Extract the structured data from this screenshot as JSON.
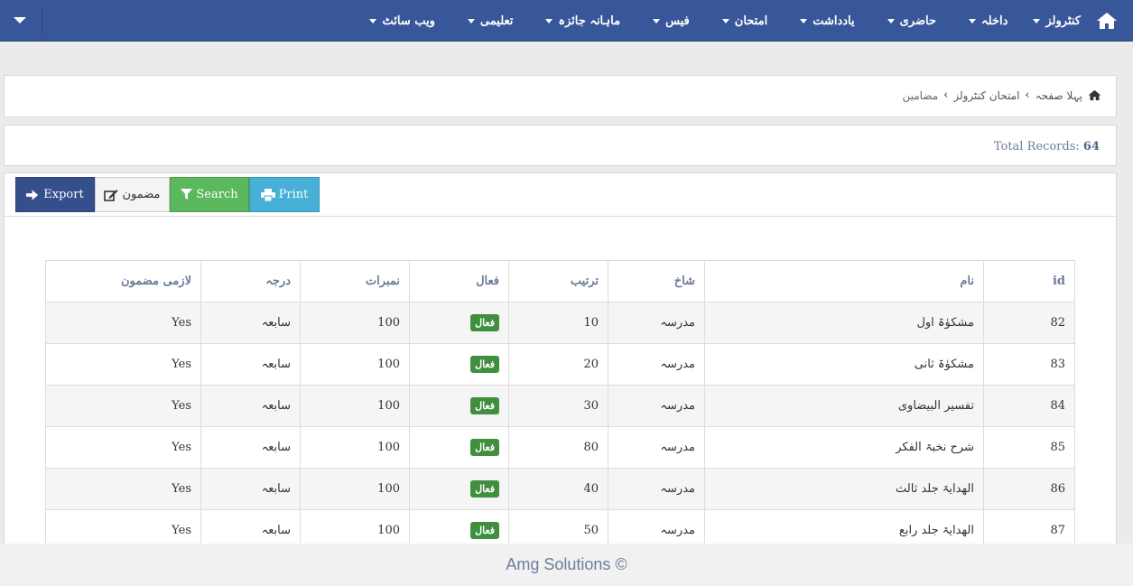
{
  "nav": {
    "items": [
      {
        "label": "کنٹرولز"
      },
      {
        "label": "داخلہ"
      },
      {
        "label": "حاضری"
      },
      {
        "label": "یادداشت"
      },
      {
        "label": "امتحان"
      },
      {
        "label": "فیس"
      },
      {
        "label": "ماہانہ جائزہ"
      },
      {
        "label": "تعلیمی"
      },
      {
        "label": "ویب سائٹ"
      }
    ]
  },
  "breadcrumb": {
    "home": "پہلا صفحہ",
    "section": "امتحان کنٹرولز",
    "current": "مضامین"
  },
  "records": {
    "label": "Total Records:",
    "count": "64"
  },
  "toolbar": {
    "export_label": "Export",
    "subject_label": "مضمون",
    "search_label": "Search",
    "print_label": "Print"
  },
  "table": {
    "headers": {
      "id": "id",
      "name": "نام",
      "branch": "شاخ",
      "order": "ترتیب",
      "active": "فعال",
      "marks": "نمبرات",
      "grade": "درجہ",
      "required": "لازمی مضمون"
    },
    "rows": [
      {
        "id": "82",
        "name": "مشکوٰۃ اول",
        "branch": "مدرسہ",
        "order": "10",
        "active": "فعال",
        "marks": "100",
        "grade": "سابعہ",
        "required": "Yes"
      },
      {
        "id": "83",
        "name": "مشکوٰۃ ثانی",
        "branch": "مدرسہ",
        "order": "20",
        "active": "فعال",
        "marks": "100",
        "grade": "سابعہ",
        "required": "Yes"
      },
      {
        "id": "84",
        "name": "تفسیر البیضاوی",
        "branch": "مدرسہ",
        "order": "30",
        "active": "فعال",
        "marks": "100",
        "grade": "سابعہ",
        "required": "Yes"
      },
      {
        "id": "85",
        "name": "شرح نخبۃ الفکر",
        "branch": "مدرسہ",
        "order": "80",
        "active": "فعال",
        "marks": "100",
        "grade": "سابعہ",
        "required": "Yes"
      },
      {
        "id": "86",
        "name": "الھدایۃ جلد ثالث",
        "branch": "مدرسہ",
        "order": "40",
        "active": "فعال",
        "marks": "100",
        "grade": "سابعہ",
        "required": "Yes"
      },
      {
        "id": "87",
        "name": "الھدایۃ جلد رابع",
        "branch": "مدرسہ",
        "order": "50",
        "active": "فعال",
        "marks": "100",
        "grade": "سابعہ",
        "required": "Yes"
      }
    ]
  },
  "footer": {
    "text": "Amg Solutions ©"
  },
  "colors": {
    "nav_bg": "#38579a",
    "export_btn": "#354f8c",
    "search_btn": "#5cb85c",
    "print_btn": "#46b0d6",
    "active_badge": "#3f8f3f"
  },
  "icons": {
    "home": "home-icon",
    "export": "sign-in-arrow-icon",
    "subject": "edit-icon",
    "search": "filter-icon",
    "print": "printer-icon",
    "dropdown": "caret-down-icon"
  }
}
